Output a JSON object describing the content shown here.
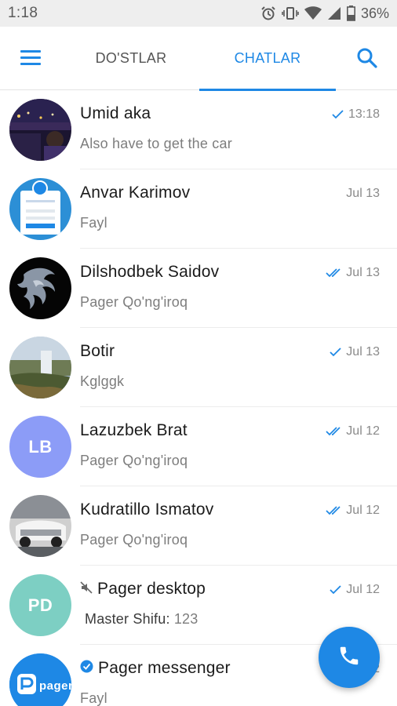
{
  "status_bar": {
    "time": "1:18",
    "battery": "36%",
    "icons": [
      "alarm-icon",
      "vibrate-icon",
      "wifi-icon",
      "signal-icon",
      "battery-icon"
    ]
  },
  "header": {
    "tabs": [
      {
        "label": "DO'STLAR",
        "active": false
      },
      {
        "label": "CHATLAR",
        "active": true
      }
    ]
  },
  "colors": {
    "accent": "#1e88e5",
    "avatar_lb": "#8c9cf7",
    "avatar_pd": "#7dcfc3"
  },
  "chats": [
    {
      "name": "Umid aka",
      "preview": "Also have to get the car",
      "time": "13:18",
      "status": "sent",
      "avatar": "photo"
    },
    {
      "name": "Anvar Karimov",
      "preview": "Fayl",
      "time": "Jul 13",
      "status": "",
      "avatar": "photo"
    },
    {
      "name": "Dilshodbek Saidov",
      "preview": "Pager Qo'ng'iroq",
      "time": "Jul 13",
      "status": "read",
      "avatar": "photo"
    },
    {
      "name": "Botir",
      "preview": "Kglggk",
      "time": "Jul 13",
      "status": "sent",
      "avatar": "photo"
    },
    {
      "name": "Lazuzbek Brat",
      "preview": "Pager Qo'ng'iroq",
      "time": "Jul 12",
      "status": "read",
      "avatar_initials": "LB"
    },
    {
      "name": "Kudratillo Ismatov",
      "preview": "Pager Qo'ng'iroq",
      "time": "Jul 12",
      "status": "read",
      "avatar": "photo"
    },
    {
      "name": "Pager desktop",
      "preview_sender": "Master Shifu:",
      "preview": " 123",
      "time": "Jul 12",
      "status": "sent",
      "muted": true,
      "avatar_initials": "PD"
    },
    {
      "name": "Pager messenger",
      "preview": "Fayl",
      "time": "12",
      "verified": true,
      "avatar": "logo"
    }
  ]
}
